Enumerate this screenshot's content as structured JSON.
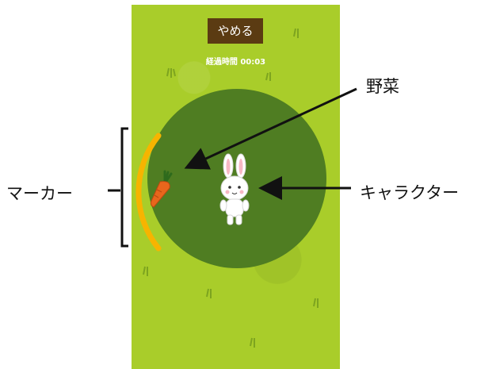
{
  "game": {
    "quit_label": "やめる",
    "elapsed_label": "経過時間",
    "elapsed_time": "00:03"
  },
  "annotations": {
    "vegetable": "野菜",
    "marker": "マーカー",
    "character": "キャラクター"
  },
  "colors": {
    "grass": "#a9cd2a",
    "circle": "#4f7d22",
    "marker": "#f7b400",
    "quit_button": "#5b3b12"
  },
  "icons": {
    "vegetable": "carrot-icon",
    "character": "rabbit-icon"
  }
}
